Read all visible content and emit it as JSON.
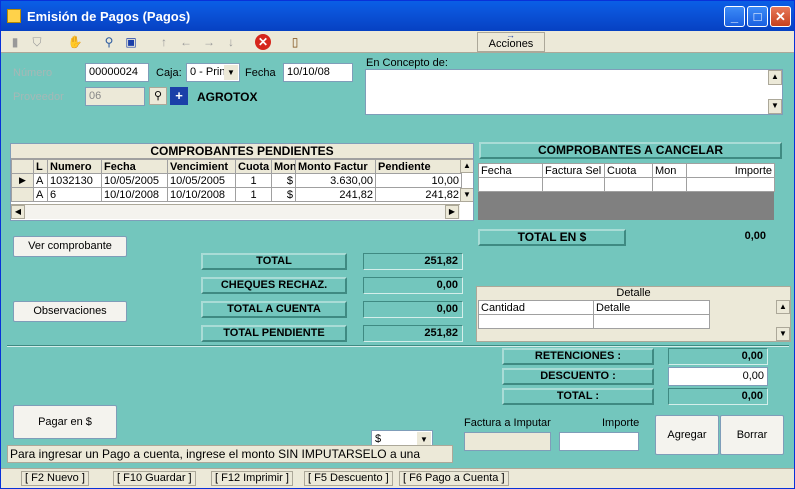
{
  "window": {
    "title": "Emisión de Pagos (Pagos)"
  },
  "toolbar": {
    "acciones_label": "Acciones"
  },
  "form": {
    "numero_label": "Número",
    "numero_value": "00000024",
    "caja_label": "Caja:",
    "caja_value": "0 - Prin",
    "fecha_label": "Fecha",
    "fecha_value": "10/10/08",
    "proveedor_label": "Proveedor",
    "proveedor_code": "06",
    "proveedor_name": "AGROTOX",
    "concepto_label": "En Concepto de:"
  },
  "pendientes": {
    "title": "COMPROBANTES PENDIENTES",
    "columns": [
      "L",
      "Numero",
      "Fecha",
      "Vencimient",
      "Cuota",
      "Mon",
      "Monto Factur",
      "Pendiente"
    ],
    "rows": [
      [
        "A",
        "1032130",
        "10/05/2005",
        "10/05/2005",
        "1",
        "$",
        "3.630,00",
        "10,00"
      ],
      [
        "A",
        "6",
        "10/10/2008",
        "10/10/2008",
        "1",
        "$",
        "241,82",
        "241,82"
      ]
    ]
  },
  "cancelar": {
    "title": "COMPROBANTES A CANCELAR",
    "columns": [
      "Fecha",
      "Factura Sel",
      "Cuota",
      "Mon",
      "Importe"
    ],
    "total_label": "TOTAL EN $",
    "total_value": "0,00"
  },
  "totals": {
    "total_label": "TOTAL",
    "total_value": "251,82",
    "cheques_label": "CHEQUES RECHAZ.",
    "cheques_value": "0,00",
    "a_cuenta_label": "TOTAL A CUENTA",
    "a_cuenta_value": "0,00",
    "pendiente_label": "TOTAL PENDIENTE",
    "pendiente_value": "251,82"
  },
  "buttons": {
    "ver_comprobante": "Ver comprobante",
    "observaciones": "Observaciones",
    "pagar": "Pagar en $",
    "agregar": "Agregar",
    "borrar": "Borrar"
  },
  "detalle": {
    "title": "Detalle",
    "columns": [
      "Cantidad",
      "Detalle"
    ]
  },
  "retenciones": {
    "retenciones_label": "RETENCIONES :",
    "retenciones_value": "0,00",
    "descuento_label": "DESCUENTO :",
    "descuento_value": "0,00",
    "total_label": "TOTAL :",
    "total_value": "0,00"
  },
  "imputar": {
    "factura_label": "Factura a Imputar",
    "importe_label": "Importe",
    "currency_value": "$"
  },
  "hint": "Para ingresar un Pago a cuenta, ingrese el monto SIN IMPUTARSELO a una",
  "statusbar": [
    "[ F2 Nuevo ]",
    "[ F10 Guardar ]",
    "[ F12 Imprimir ]",
    "[ F5 Descuento ]",
    "[ F6 Pago a Cuenta ]"
  ]
}
